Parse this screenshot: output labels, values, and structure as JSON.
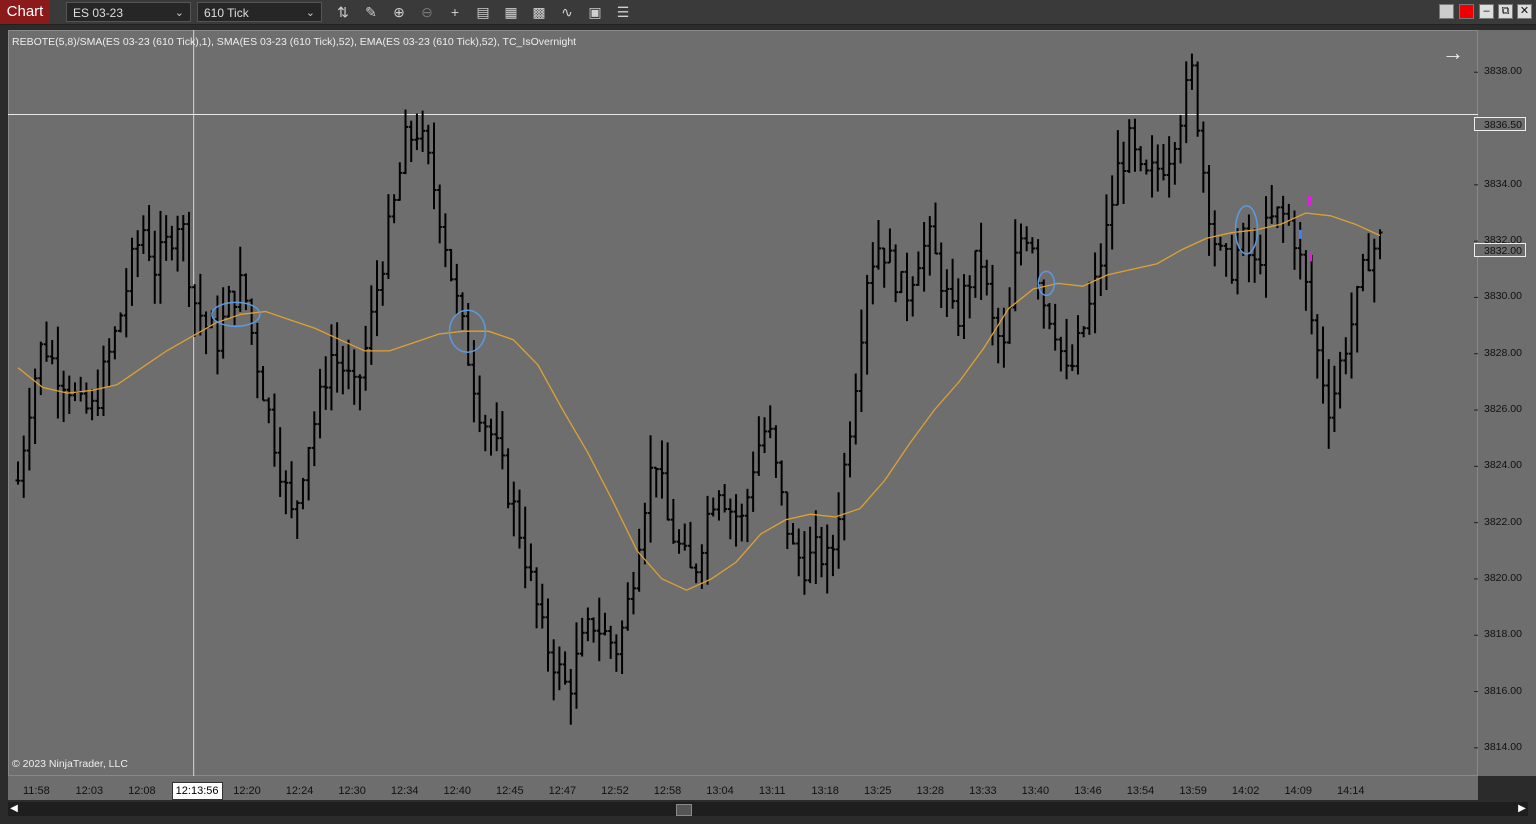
{
  "toolbar": {
    "chart_tab": "Chart",
    "instrument": "ES 03-23",
    "interval": "610 Tick"
  },
  "icons": [
    "bars-type-icon",
    "pencil-draw-icon",
    "zoom-in-icon",
    "zoom-out-icon",
    "crosshair-icon",
    "properties-icon",
    "templates-icon",
    "strategies-icon",
    "indicators-icon",
    "data-box-icon",
    "list-icon"
  ],
  "indicator_label": "REBOTE(5,8)/SMA(ES 03-23 (610 Tick),1), SMA(ES 03-23 (610 Tick),52), EMA(ES 03-23 (610 Tick),52), TC_IsOvernight",
  "copyright": "© 2023 NinjaTrader, LLC",
  "colors": {
    "chart_bg": "#6e6e6e",
    "bars": "#000000",
    "ema": "#e0a030",
    "ellipse": "#5a9ae0",
    "magenta": "#e020e0",
    "blue_marker": "#4080ff",
    "chart_tab": "#8b1a1a"
  },
  "chart_data": {
    "type": "line",
    "ylim": [
      3813.0,
      3839.5
    ],
    "y_ticks": [
      "3838.00",
      "3836.00",
      "3834.00",
      "3832.00",
      "3830.00",
      "3828.00",
      "3826.00",
      "3824.00",
      "3822.00",
      "3820.00",
      "3818.00",
      "3816.00",
      "3814.00"
    ],
    "x_ticks": [
      "11:58",
      "12:03",
      "12:08",
      "12:13:56",
      "12:20",
      "12:24",
      "12:30",
      "12:34",
      "12:40",
      "12:45",
      "12:47",
      "12:52",
      "12:58",
      "13:04",
      "13:11",
      "13:18",
      "13:25",
      "13:28",
      "13:33",
      "13:40",
      "13:46",
      "13:54",
      "13:59",
      "14:02",
      "14:09",
      "14:14"
    ],
    "crosshair_x": "12:13:56",
    "crosshair_price": "3836.50",
    "last_price": "3832.00",
    "close_series": [
      3823.5,
      3826.5,
      3828.5,
      3827.5,
      3827.0,
      3826.0,
      3826.0,
      3827.5,
      3829.0,
      3831.0,
      3832.5,
      3831.0,
      3832.0,
      3833.0,
      3830.0,
      3829.0,
      3828.5,
      3830.0,
      3830.5,
      3828.0,
      3826.0,
      3824.0,
      3822.0,
      3824.5,
      3826.0,
      3828.0,
      3827.5,
      3826.5,
      3828.5,
      3831.0,
      3833.0,
      3835.5,
      3836.0,
      3834.5,
      3832.5,
      3830.0,
      3828.0,
      3826.0,
      3825.0,
      3823.5,
      3822.0,
      3820.0,
      3818.0,
      3817.0,
      3816.0,
      3817.5,
      3818.5,
      3818.0,
      3817.5,
      3819.5,
      3822.5,
      3824.5,
      3822.0,
      3821.0,
      3820.0,
      3822.0,
      3823.5,
      3822.5,
      3822.0,
      3824.5,
      3825.5,
      3823.0,
      3821.0,
      3820.5,
      3821.0,
      3820.5,
      3823.5,
      3827.0,
      3831.0,
      3832.0,
      3831.0,
      3830.0,
      3831.5,
      3832.0,
      3830.5,
      3829.0,
      3830.5,
      3831.5,
      3829.0,
      3828.0,
      3832.0,
      3832.5,
      3830.0,
      3829.0,
      3827.0,
      3828.5,
      3830.0,
      3832.0,
      3834.5,
      3835.5,
      3834.0,
      3834.5,
      3835.0,
      3836.5,
      3838.0,
      3834.0,
      3831.5,
      3831.0,
      3832.0,
      3831.0,
      3832.5,
      3833.0,
      3832.5,
      3830.5,
      3828.0,
      3826.0,
      3828.0,
      3829.5,
      3831.5,
      3832.0
    ],
    "ema_series": [
      3827.5,
      3826.8,
      3826.6,
      3826.7,
      3826.9,
      3827.5,
      3828.1,
      3828.6,
      3829.1,
      3829.4,
      3829.5,
      3829.2,
      3828.9,
      3828.5,
      3828.1,
      3828.1,
      3828.4,
      3828.7,
      3828.8,
      3828.8,
      3828.5,
      3827.6,
      3826.0,
      3824.5,
      3822.8,
      3821.0,
      3820.0,
      3819.6,
      3820.0,
      3820.6,
      3821.6,
      3822.1,
      3822.3,
      3822.2,
      3822.5,
      3823.5,
      3824.8,
      3826.0,
      3827.0,
      3828.2,
      3829.6,
      3830.3,
      3830.5,
      3830.4,
      3830.8,
      3831.0,
      3831.2,
      3831.7,
      3832.1,
      3832.3,
      3832.4,
      3832.6,
      3833.0,
      3832.9,
      3832.6,
      3832.2
    ],
    "series": [
      {
        "name": "EMA(ES 03-23 (610 Tick),52)",
        "values": []
      }
    ]
  }
}
